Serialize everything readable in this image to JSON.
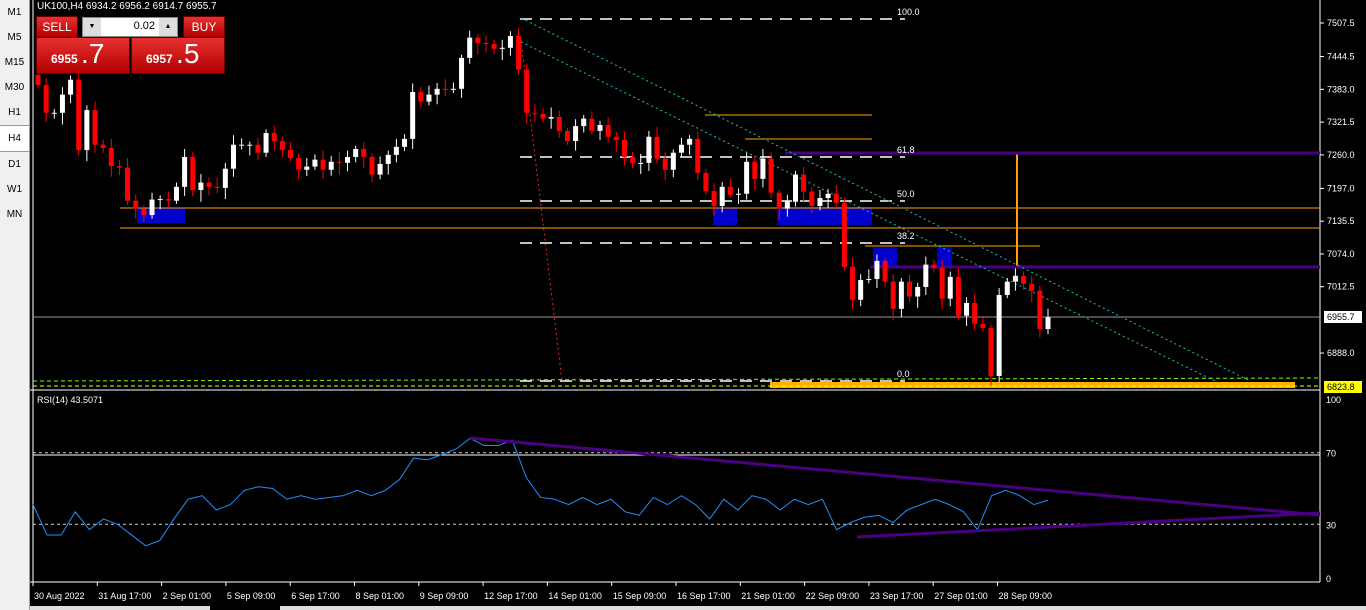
{
  "window": {
    "title": "UK100,H4  6934.2 6956.2 6914.7 6955.7"
  },
  "timeframes": [
    "M1",
    "M5",
    "M15",
    "M30",
    "H1",
    "H4",
    "D1",
    "W1",
    "MN"
  ],
  "active_timeframe": "H4",
  "trade_panel": {
    "sell_label": "SELL",
    "buy_label": "BUY",
    "lot": "0.02",
    "sell_big": "6955",
    "sell_small": ".7",
    "buy_big": "6957",
    "buy_small": ".5"
  },
  "price_axis": {
    "ticks": [
      "7507.5",
      "7444.5",
      "7383.0",
      "7321.5",
      "7260.0",
      "7197.0",
      "7135.5",
      "7074.0",
      "7012.5",
      "6888.0"
    ],
    "current_price": "6955.7",
    "marker_price": "6823.8"
  },
  "time_axis": [
    "30 Aug 2022",
    "31 Aug 17:00",
    "2 Sep 01:00",
    "5 Sep 09:00",
    "6 Sep 17:00",
    "8 Sep 01:00",
    "9 Sep 09:00",
    "12 Sep 17:00",
    "14 Sep 01:00",
    "15 Sep 09:00",
    "16 Sep 17:00",
    "21 Sep 01:00",
    "22 Sep 09:00",
    "23 Sep 17:00",
    "27 Sep 01:00",
    "28 Sep 09:00"
  ],
  "fib_labels": [
    "100.0",
    "61.8",
    "50.0",
    "38.2",
    "0.0"
  ],
  "rsi": {
    "label": "RSI(14) 43.5071",
    "ticks": [
      "100",
      "70",
      "30",
      "0"
    ]
  },
  "colors": {
    "bull": "#ffffff",
    "bear": "#ff0000",
    "zone": "#0000cc",
    "purple": "#4b0082",
    "orange": "#ffa500",
    "rsi": "#1e90ff",
    "fib": "#ffffff"
  },
  "chart_data": {
    "type": "candlestick",
    "first_open": 7410,
    "closes": [
      7391,
      7339,
      7339,
      7373,
      7401,
      7269,
      7344,
      7279,
      7273,
      7239,
      7236,
      7174,
      7159,
      7147,
      7176,
      7177,
      7174,
      7200,
      7256,
      7194,
      7208,
      7200,
      7198,
      7234,
      7279,
      7279,
      7279,
      7264,
      7301,
      7286,
      7269,
      7254,
      7232,
      7238,
      7251,
      7232,
      7247,
      7245,
      7256,
      7271,
      7256,
      7223,
      7243,
      7260,
      7275,
      7290,
      7378,
      7360,
      7373,
      7384,
      7382,
      7384,
      7442,
      7480,
      7470,
      7468,
      7459,
      7461,
      7483,
      7420,
      7339,
      7337,
      7328,
      7331,
      7305,
      7286,
      7314,
      7328,
      7305,
      7316,
      7294,
      7288,
      7256,
      7245,
      7245,
      7294,
      7253,
      7232,
      7264,
      7279,
      7290,
      7226,
      7192,
      7164,
      7200,
      7185,
      7187,
      7247,
      7215,
      7253,
      7189,
      7159,
      7172,
      7223,
      7191,
      7164,
      7179,
      7187,
      7170,
      7050,
      6988,
      7025,
      7027,
      7061,
      7022,
      6971,
      7022,
      6994,
      7012,
      7054,
      7048,
      6990,
      7031,
      6958,
      6982,
      6943,
      6935,
      6845,
      6997,
      7022,
      7033,
      7018,
      7005,
      6933,
      6955
    ],
    "ylim": [
      6823.8,
      7520
    ],
    "rsi_values": [
      41,
      24,
      24,
      37,
      27,
      33,
      30,
      24,
      18,
      21,
      33,
      44,
      46,
      38,
      41,
      49,
      51,
      50,
      44,
      46,
      44,
      45,
      46,
      49,
      46,
      49,
      55,
      67,
      66,
      69,
      72,
      78,
      74,
      74,
      77,
      56,
      45,
      44,
      41,
      45,
      41,
      44,
      37,
      35,
      45,
      41,
      46,
      41,
      33,
      44,
      38,
      46,
      44,
      38,
      44,
      41,
      44,
      27,
      31,
      34,
      35,
      31,
      38,
      41,
      44,
      41,
      37,
      27,
      46,
      49,
      46,
      41,
      43.5
    ]
  }
}
